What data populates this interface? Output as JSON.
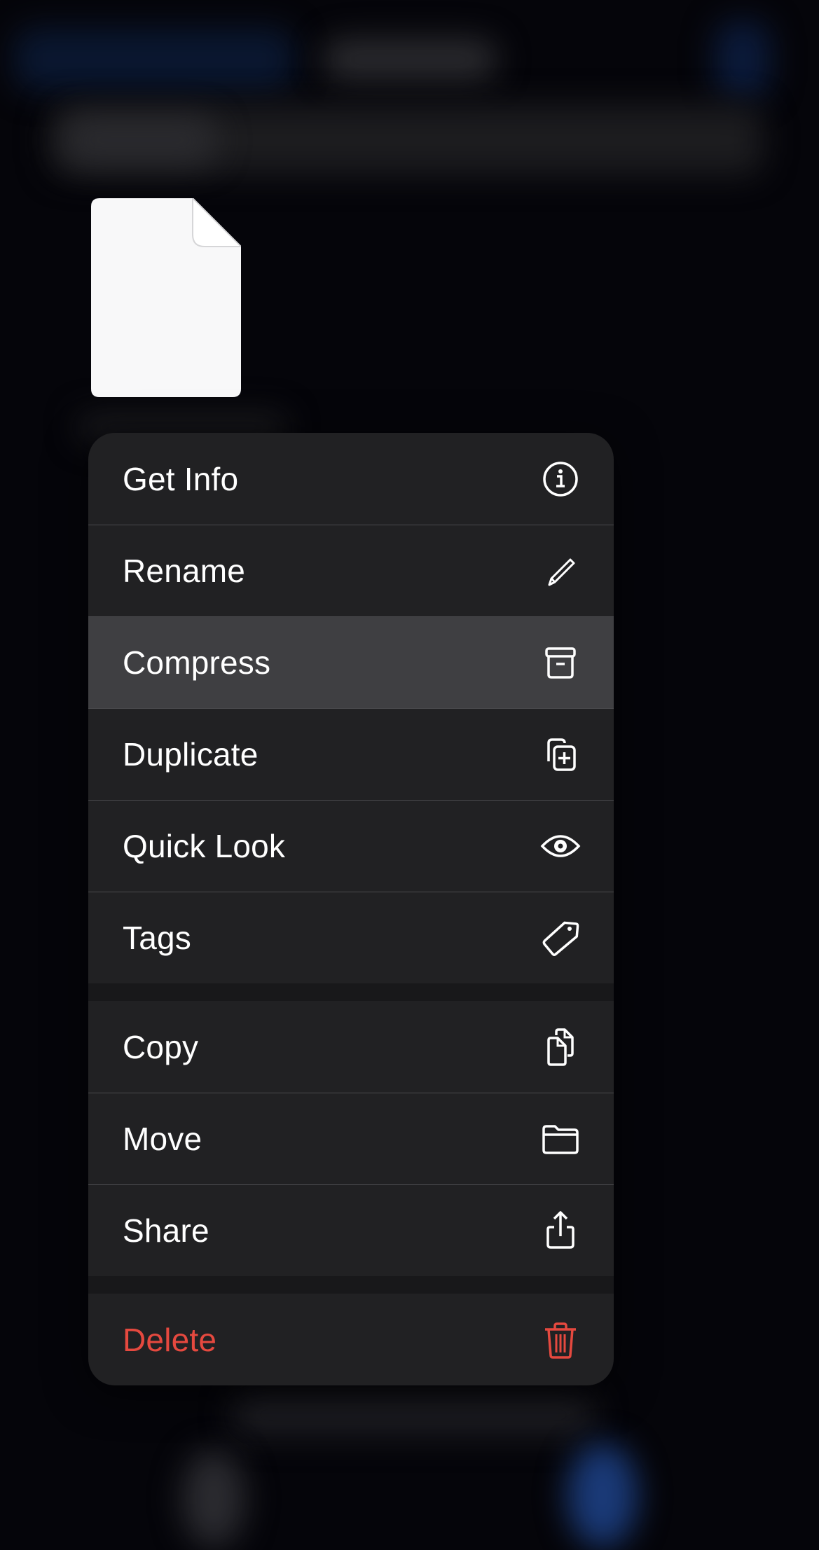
{
  "file": {
    "icon": "document-icon"
  },
  "colors": {
    "menu_background": "#212123",
    "highlight": "#3f3f42",
    "text": "#ffffff",
    "destructive": "#e5493f",
    "separator": "#4a4a4d"
  },
  "menu": {
    "groups": [
      {
        "items": [
          {
            "label": "Get Info",
            "icon": "info-circle-icon"
          },
          {
            "label": "Rename",
            "icon": "pencil-icon"
          },
          {
            "label": "Compress",
            "icon": "archive-box-icon",
            "highlighted": true
          },
          {
            "label": "Duplicate",
            "icon": "duplicate-plus-icon"
          },
          {
            "label": "Quick Look",
            "icon": "eye-icon"
          },
          {
            "label": "Tags",
            "icon": "tag-icon"
          }
        ]
      },
      {
        "items": [
          {
            "label": "Copy",
            "icon": "copy-documents-icon"
          },
          {
            "label": "Move",
            "icon": "folder-icon"
          },
          {
            "label": "Share",
            "icon": "share-icon"
          }
        ]
      },
      {
        "items": [
          {
            "label": "Delete",
            "icon": "trash-icon",
            "destructive": true
          }
        ]
      }
    ]
  }
}
